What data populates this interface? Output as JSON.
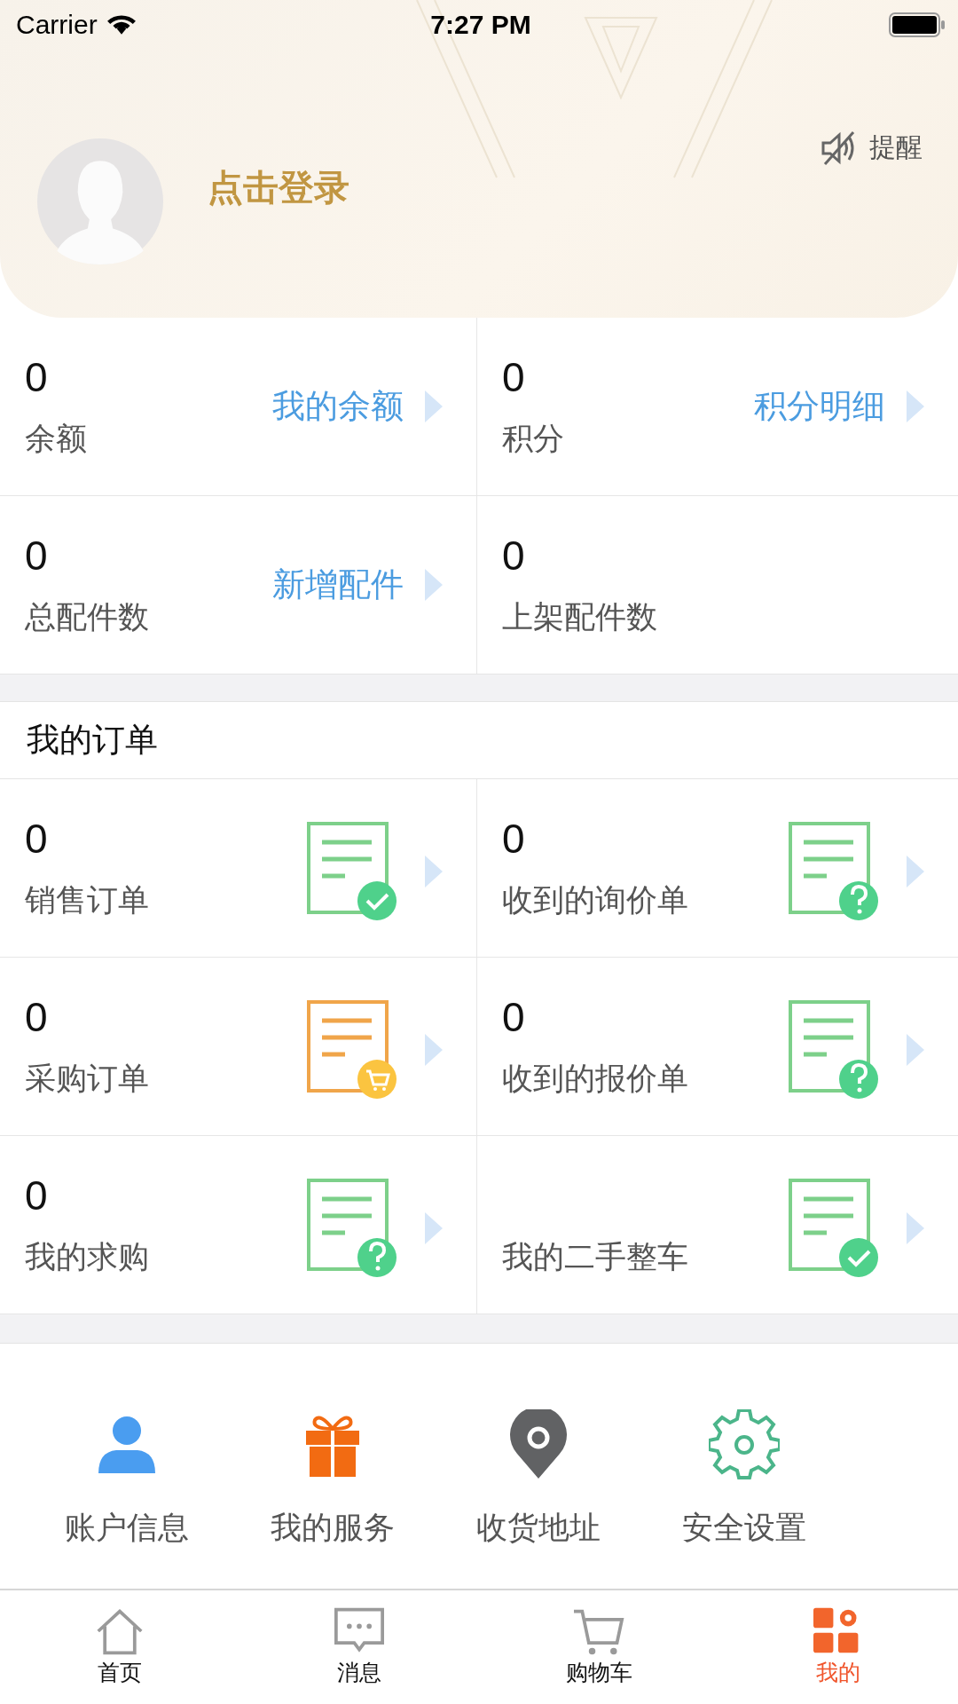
{
  "status_bar": {
    "carrier": "Carrier",
    "time": "7:27 PM"
  },
  "profile": {
    "login": "点击登录",
    "reminder": "提醒"
  },
  "stats": [
    {
      "value": "0",
      "label": "余额",
      "link": "我的余额"
    },
    {
      "value": "0",
      "label": "积分",
      "link": "积分明细"
    },
    {
      "value": "0",
      "label": "总配件数",
      "link": "新增配件"
    },
    {
      "value": "0",
      "label": "上架配件数"
    }
  ],
  "orders": {
    "title": "我的订单",
    "items": [
      {
        "value": "0",
        "label": "销售订单",
        "kind": "check"
      },
      {
        "value": "0",
        "label": "收到的询价单",
        "kind": "question"
      },
      {
        "value": "0",
        "label": "采购订单",
        "kind": "cart"
      },
      {
        "value": "0",
        "label": "收到的报价单",
        "kind": "question"
      },
      {
        "value": "0",
        "label": "我的求购",
        "kind": "question"
      },
      {
        "label": "我的二手整车",
        "kind": "check"
      }
    ]
  },
  "services": [
    {
      "label": "账户信息",
      "kind": "person"
    },
    {
      "label": "我的服务",
      "kind": "gift"
    },
    {
      "label": "收货地址",
      "kind": "pin"
    },
    {
      "label": "安全设置",
      "kind": "gear"
    }
  ],
  "tabs": [
    {
      "label": "首页",
      "kind": "home",
      "selected": false
    },
    {
      "label": "消息",
      "kind": "message",
      "selected": false
    },
    {
      "label": "购物车",
      "kind": "cart",
      "selected": false
    },
    {
      "label": "我的",
      "kind": "grid",
      "selected": true
    }
  ]
}
